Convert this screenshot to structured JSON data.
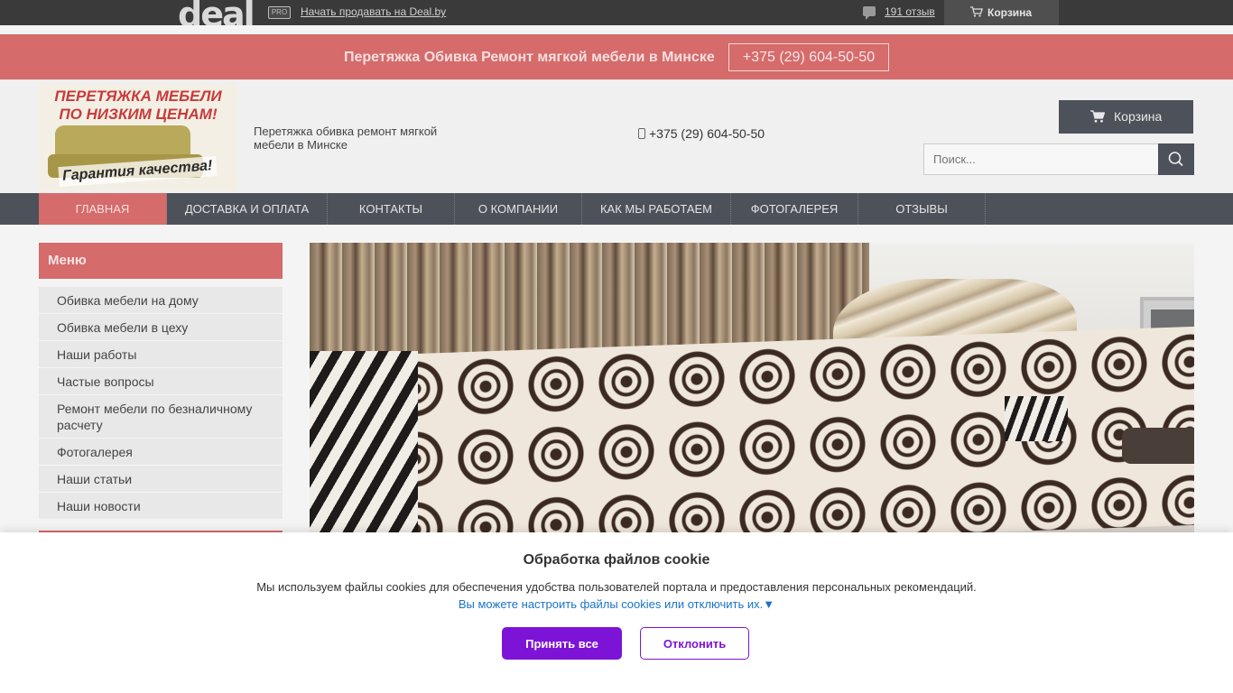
{
  "portal_bar": {
    "logo_text": "deal",
    "pro_badge": "PRO",
    "sell_link": "Начать продавать на Deal.by",
    "reviews_link": "191 отзыв",
    "cart_label": "Корзина",
    "icons": [
      "speech-bubble-icon",
      "cart-icon"
    ]
  },
  "banner": {
    "title": "Перетяжка Обивка Ремонт мягкой мебели в Минске",
    "phone": "+375 (29) 604-50-50",
    "color": "#d56b6b"
  },
  "header": {
    "logo": {
      "line1": "ПЕРЕТЯЖКА МЕБЕЛИ",
      "line2": "ПО НИЗКИМ ЦЕНАМ!",
      "guarantee": "Гарантия качества!"
    },
    "description": "Перетяжка обивка ремонт мягкой мебели в Минске",
    "phone": "+375 (29) 604-50-50",
    "cart_label": "Корзина",
    "search_placeholder": "Поиск..."
  },
  "nav": {
    "items": [
      {
        "label": "ГЛАВНАЯ",
        "active": true
      },
      {
        "label": "ДОСТАВКА И ОПЛАТА"
      },
      {
        "label": "КОНТАКТЫ"
      },
      {
        "label": "О КОМПАНИИ"
      },
      {
        "label": "КАК МЫ РАБОТАЕМ"
      },
      {
        "label": "ФОТОГАЛЕРЕЯ"
      },
      {
        "label": "ОТЗЫВЫ"
      }
    ]
  },
  "sidebar": {
    "heading": "Меню",
    "items": [
      {
        "label": "Обивка мебели на дому"
      },
      {
        "label": "Обивка мебели в цеху"
      },
      {
        "label": "Наши работы"
      },
      {
        "label": "Частые вопросы"
      },
      {
        "label": "Ремонт мебели по безналичному расчету"
      },
      {
        "label": "Фотогалерея"
      },
      {
        "label": "Наши статьи"
      },
      {
        "label": "Наши новости"
      }
    ]
  },
  "cookie": {
    "title": "Обработка файлов cookie",
    "text": "Мы используем файлы cookies для обеспечения удобства пользователей портала и предоставления персональных рекомендаций.",
    "link": "Вы можете настроить файлы cookies или отключить их.▼",
    "accept": "Принять все",
    "decline": "Отклонить",
    "accent": "#7d13d6"
  }
}
